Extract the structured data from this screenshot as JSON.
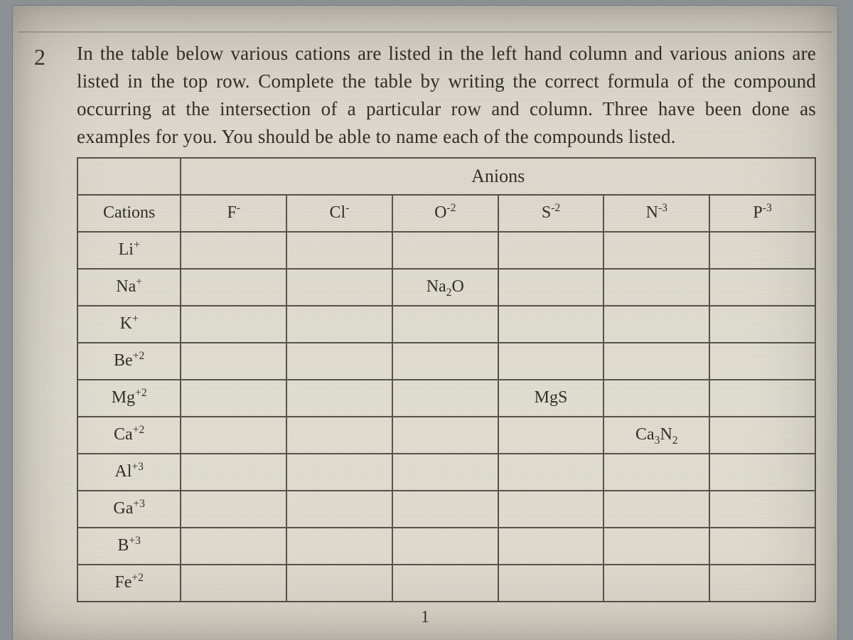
{
  "question_number": "2",
  "prompt_text": "In the table below various cations are listed in the left hand column and various anions are listed in the top row.  Complete the table by writing the correct formula of the compound occurring at the intersection of a particular row and column.   Three have been done as examples for you.  You should be able to name each of the compounds listed.",
  "anions_title": "Anions",
  "cations_title": "Cations",
  "anions": [
    {
      "base": "F",
      "sup": "-"
    },
    {
      "base": "Cl",
      "sup": "-"
    },
    {
      "base": "O",
      "sup": "-2"
    },
    {
      "base": "S",
      "sup": "-2"
    },
    {
      "base": "N",
      "sup": "-3"
    },
    {
      "base": "P",
      "sup": "-3"
    }
  ],
  "cations": [
    {
      "base": "Li",
      "sup": "+"
    },
    {
      "base": "Na",
      "sup": "+"
    },
    {
      "base": "K",
      "sup": "+"
    },
    {
      "base": "Be",
      "sup": "+2"
    },
    {
      "base": "Mg",
      "sup": "+2"
    },
    {
      "base": "Ca",
      "sup": "+2"
    },
    {
      "base": "Al",
      "sup": "+3"
    },
    {
      "base": "Ga",
      "sup": "+3"
    },
    {
      "base": "B",
      "sup": "+3"
    },
    {
      "base": "Fe",
      "sup": "+2"
    }
  ],
  "cells": {
    "1_2": {
      "tokens": [
        {
          "t": "Na"
        },
        {
          "t": "2",
          "sub": true
        },
        {
          "t": "O"
        }
      ]
    },
    "4_3": {
      "tokens": [
        {
          "t": "MgS"
        }
      ]
    },
    "5_4": {
      "tokens": [
        {
          "t": "Ca"
        },
        {
          "t": "3",
          "sub": true
        },
        {
          "t": "N"
        },
        {
          "t": "2",
          "sub": true
        }
      ]
    }
  },
  "page_number": "1"
}
